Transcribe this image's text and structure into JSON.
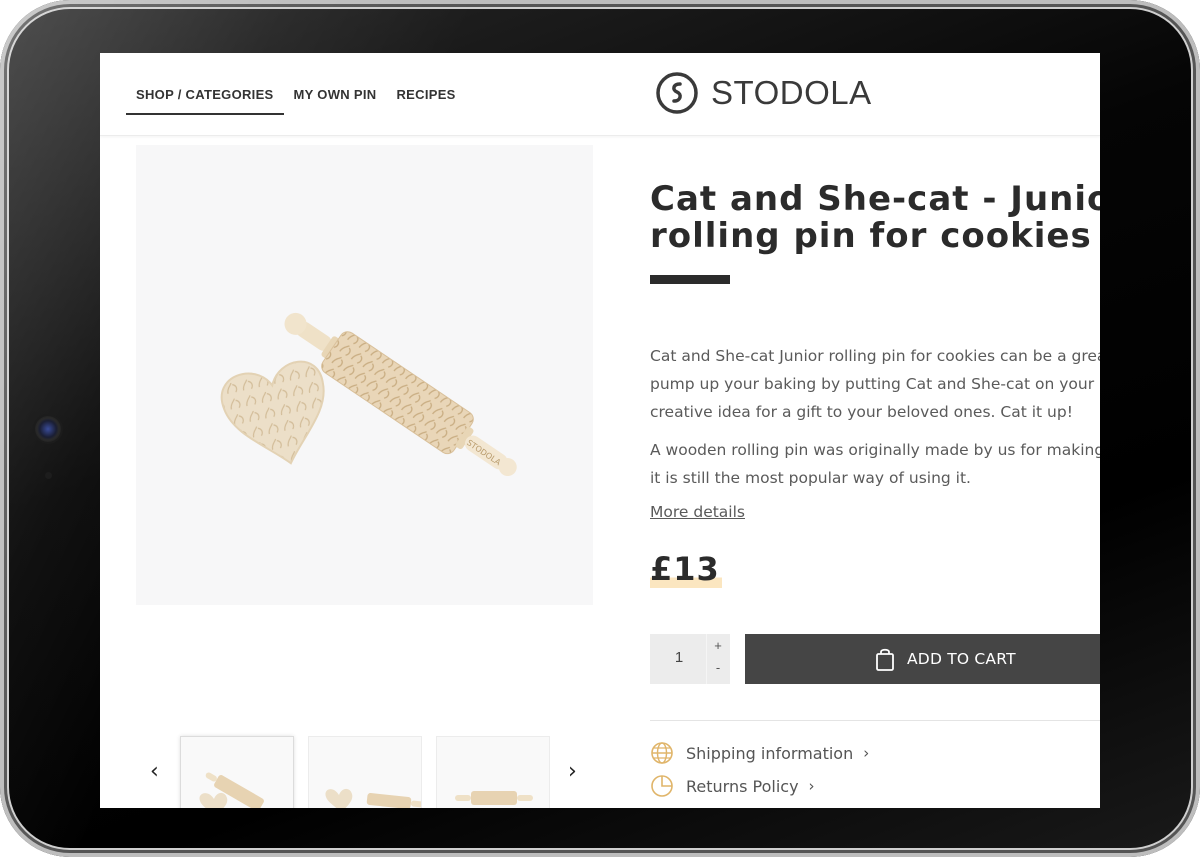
{
  "nav": {
    "items": [
      {
        "label": "SHOP / CATEGORIES",
        "active": true
      },
      {
        "label": "MY OWN PIN",
        "active": false
      },
      {
        "label": "RECIPES",
        "active": false
      }
    ]
  },
  "brand": {
    "name": "STODOLA"
  },
  "product": {
    "title_line1": "Cat and She-cat - Junior",
    "title_line2": "rolling pin for cookies",
    "description": [
      "Cat and She-cat Junior rolling pin for cookies can be a great",
      "pump up your baking by putting Cat and She-cat on your",
      "creative idea for a gift to your beloved ones. Cat it up!"
    ],
    "description2": [
      "A wooden rolling pin was originally made by us for making",
      "it is still the most popular way of using it."
    ],
    "more_details": "More details",
    "price": "£13",
    "quantity": "1",
    "qty_plus": "+",
    "qty_minus": "-",
    "add_to_cart": "ADD TO CART",
    "engraving": "STODOLA"
  },
  "info": {
    "shipping": "Shipping information",
    "returns": "Returns Policy"
  },
  "colors": {
    "accent_icon": "#e0b56a",
    "button_bg": "#454545",
    "price_highlight": "#fbe6c0",
    "text_dark": "#2b2b2b"
  }
}
